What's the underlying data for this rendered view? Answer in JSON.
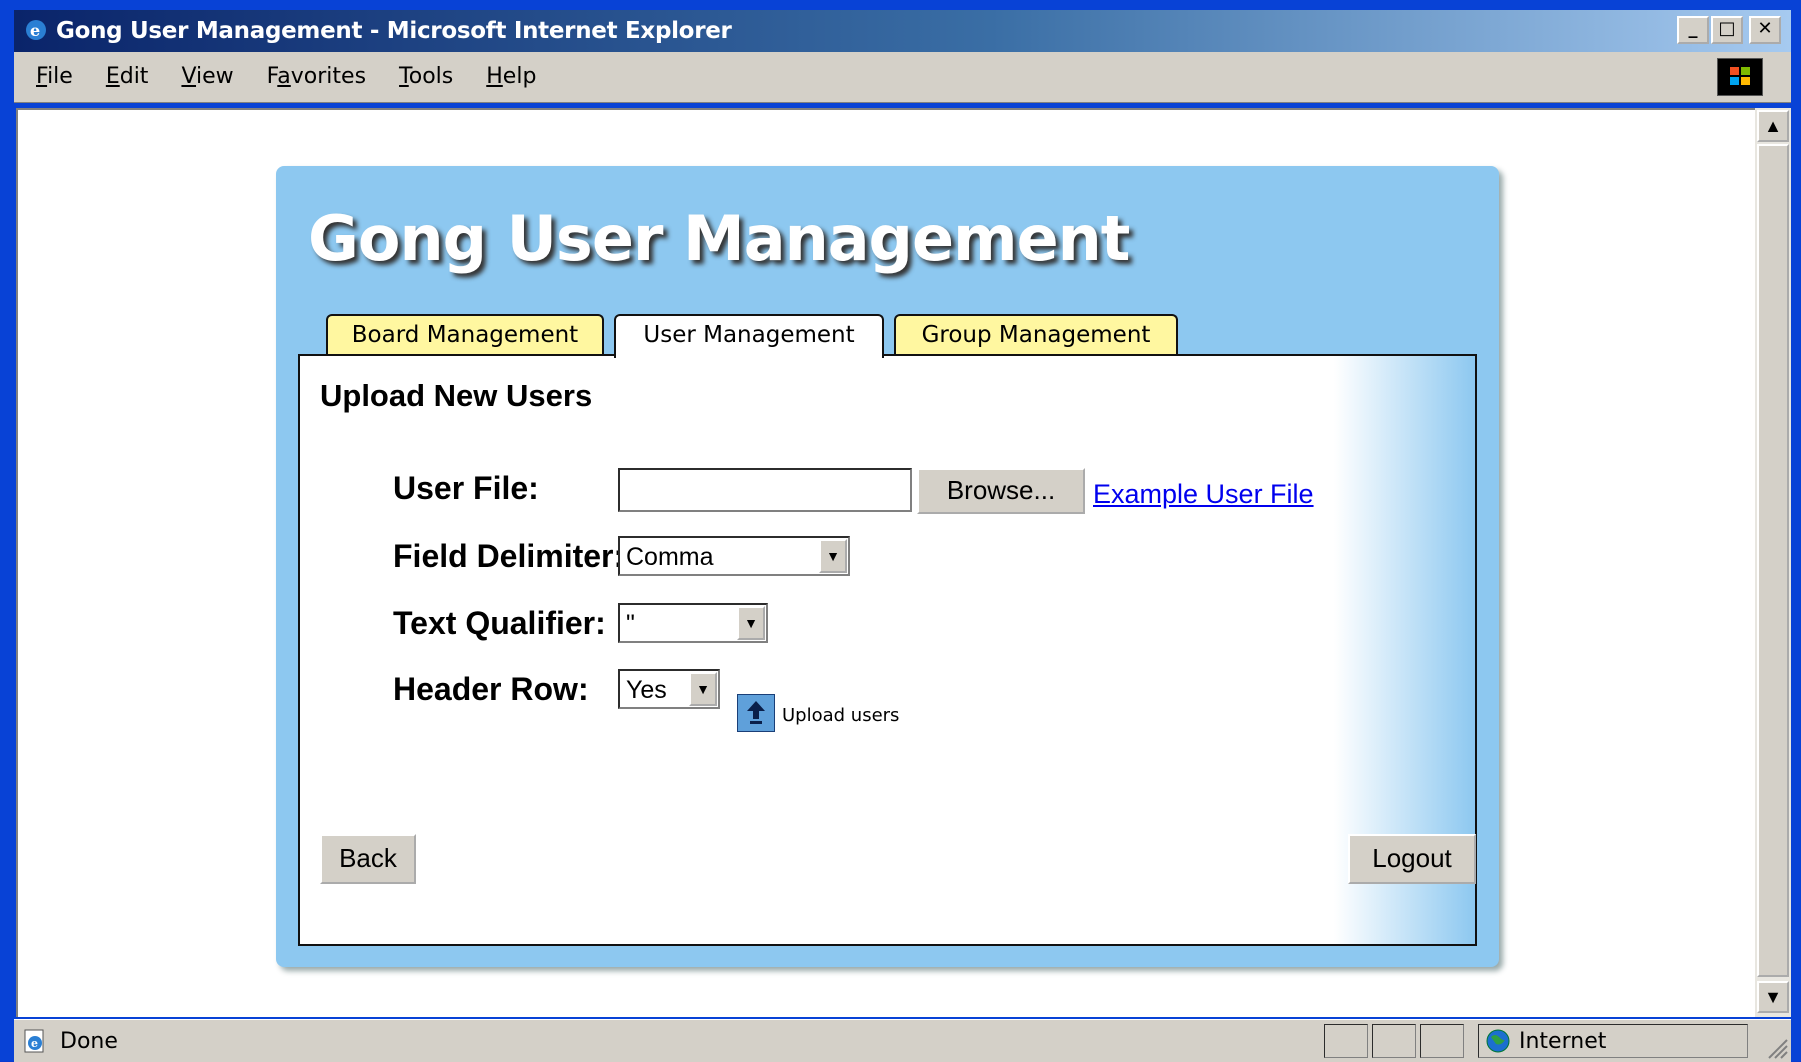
{
  "window": {
    "title": "Gong User Management - Microsoft Internet Explorer",
    "controls": {
      "minimize": "_",
      "maximize": "□",
      "close": "✕"
    }
  },
  "menu": [
    {
      "prefix": "",
      "accel": "F",
      "rest": "ile"
    },
    {
      "prefix": "",
      "accel": "E",
      "rest": "dit"
    },
    {
      "prefix": "",
      "accel": "V",
      "rest": "iew"
    },
    {
      "prefix": "F",
      "accel": "a",
      "rest": "vorites"
    },
    {
      "prefix": "",
      "accel": "T",
      "rest": "ools"
    },
    {
      "prefix": "",
      "accel": "H",
      "rest": "elp"
    }
  ],
  "page": {
    "app_title": "Gong User Management",
    "tabs": [
      {
        "label": "Board Management",
        "active": false
      },
      {
        "label": "User Management",
        "active": true
      },
      {
        "label": "Group Management",
        "active": false
      }
    ],
    "section_title": "Upload New Users",
    "form": {
      "user_file_label": "User File:",
      "user_file_value": "",
      "browse_label": "Browse...",
      "example_link": "Example User File",
      "delimiter_label": "Field Delimiter:",
      "delimiter_value": "Comma",
      "qualifier_label": "Text Qualifier:",
      "qualifier_value": "\"",
      "header_label": "Header Row:",
      "header_value": "Yes",
      "upload_label": "Upload users"
    },
    "back_label": "Back",
    "logout_label": "Logout"
  },
  "status": {
    "text": "Done",
    "zone": "Internet"
  },
  "colors": {
    "panel": "#8dc8f0",
    "tab_inactive": "#fff7a0",
    "link": "#0000ee"
  }
}
